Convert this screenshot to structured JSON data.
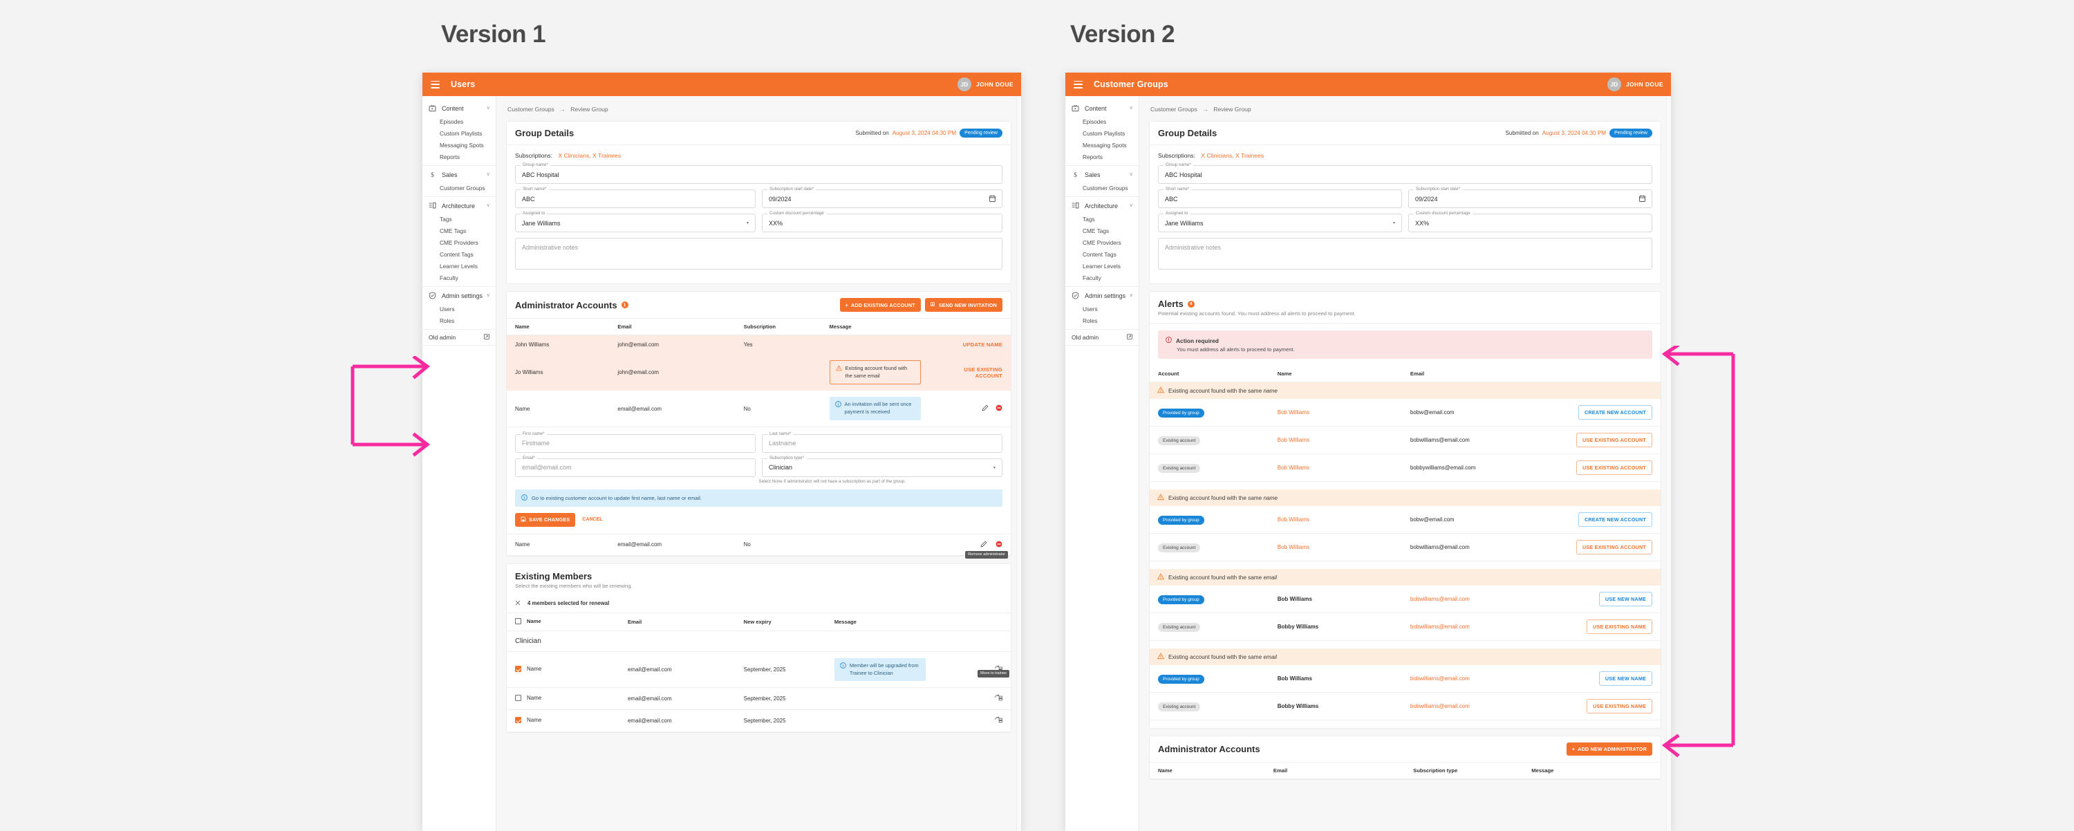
{
  "page": {
    "background": "#f4f3f3",
    "accent_orange": "#f4712b",
    "accent_blue": "#1a86d8",
    "annotation_pink": "#f72ba0"
  },
  "v1_title": "Version 1",
  "v2_title": "Version 2",
  "topbar": {
    "v1_title": "Users",
    "v2_title": "Customer Groups",
    "avatar_initials": "JD",
    "username": "JOHN DOUE",
    "menu_icon": "hamburger-icon"
  },
  "sidebar": {
    "groups": [
      {
        "label": "Content",
        "icon": "tv-icon",
        "chevron": "v",
        "items": [
          "Episodes",
          "Custom Playlists",
          "Messaging Spots",
          "Reports"
        ]
      },
      {
        "label": "Sales",
        "icon": "dollar-icon",
        "chevron": "v",
        "items": [
          "Customer Groups"
        ]
      },
      {
        "label": "Architecture",
        "icon": "layout-icon",
        "chevron": "v",
        "items": [
          "Tags",
          "CME Tags",
          "CME Providers",
          "Content Tags",
          "Learner Levels",
          "Faculty"
        ]
      },
      {
        "label": "Admin settings",
        "icon": "shield-icon",
        "chevron": "v",
        "items": [
          "Users",
          "Roles"
        ]
      }
    ],
    "footer": {
      "label": "Old admin",
      "icon": "external-link-icon"
    }
  },
  "breadcrumb": {
    "root": "Customer Groups",
    "arrow": "→",
    "current": "Review Group"
  },
  "group_details": {
    "title": "Group Details",
    "submitted_label": "Submitted on",
    "submitted_date": "August 3, 2024 04:30 PM",
    "status_chip": "Pending review",
    "subscriptions_label": "Subscriptions:",
    "subscriptions_value": "X Clinicians, X Trainees",
    "fields": {
      "group_name": {
        "legend": "Group name*",
        "value": "ABC Hospital"
      },
      "short_name": {
        "legend": "Short name*",
        "value": "ABC"
      },
      "start_date": {
        "legend": "Subscription start date*",
        "value": "09/2024",
        "icon": "calendar-icon"
      },
      "assigned_to": {
        "legend": "Assigned to",
        "value": "Jane Williams",
        "icon": "chevron-down-icon"
      },
      "discount": {
        "legend": "Custom discount percentage",
        "value": "XX%"
      },
      "notes": {
        "legend": "",
        "placeholder": "Administrative notes"
      }
    }
  },
  "v1_admin": {
    "title": "Administrator Accounts",
    "badge": "1",
    "btn_add_existing": "ADD EXISTING ACCOUNT",
    "btn_send_invitation": "SEND NEW INVITATION",
    "columns": [
      "Name",
      "Email",
      "Subscription",
      "Message"
    ],
    "rows": [
      {
        "name": "John Williams",
        "email": "john@email.com",
        "subscription": "Yes",
        "message": "",
        "action": "UPDATE NAME",
        "highlight": true
      },
      {
        "name": "Jo Williams",
        "email": "john@email.com",
        "subscription": "",
        "message": "Existing account found with the same email",
        "message_type": "warn",
        "action": "USE EXISTING ACCOUNT",
        "highlight": true
      },
      {
        "name": "Name",
        "email": "email@email.com",
        "subscription": "No",
        "message": "An invitation will be sent once payment is received",
        "message_type": "info",
        "action": "",
        "highlight": false
      }
    ],
    "edit_form": {
      "first_name": {
        "legend": "First name*",
        "placeholder": "Firstname"
      },
      "last_name": {
        "legend": "Last name*",
        "placeholder": "Lastname"
      },
      "email": {
        "legend": "Email*",
        "placeholder": "email@email.com"
      },
      "subscription_type": {
        "legend": "Subscription type*",
        "value": "Clinician"
      },
      "helper": "Select None if administrator will not have a subscription as part of the group.",
      "info": "Go to existing customer account to update first name, last name or email.",
      "save": "SAVE CHANGES",
      "cancel": "CANCEL"
    },
    "last_row": {
      "name": "Name",
      "email": "email@email.com",
      "subscription": "No"
    },
    "tooltip_remove": "Remove administrator"
  },
  "v1_members": {
    "title": "Existing Members",
    "subtitle": "Select the existing members who will be renewing.",
    "selection_text": "4 members selected for renewal",
    "clear_icon": "close-icon",
    "columns": [
      "Name",
      "Email",
      "New expiry",
      "Message"
    ],
    "group_label": "Clinician",
    "rows": [
      {
        "checked": true,
        "name": "Name",
        "email": "email@email.com",
        "expiry": "September, 2025",
        "message": "Member will be upgraded from Trainee to Clinician",
        "tooltip": "Move to trainee"
      },
      {
        "checked": false,
        "name": "Name",
        "email": "email@email.com",
        "expiry": "September, 2025",
        "message": "",
        "tooltip": ""
      },
      {
        "checked": true,
        "name": "Name",
        "email": "email@email.com",
        "expiry": "September, 2025",
        "message": "",
        "tooltip": ""
      }
    ]
  },
  "v2_alerts": {
    "title": "Alerts",
    "badge": "4",
    "subtitle": "Potential existing accounts found. You must address all alerts to proceed to payment.",
    "action_required_title": "Action required",
    "action_required_text": "You must address all alerts to proceed to payment.",
    "columns": [
      "Account",
      "Name",
      "Email"
    ],
    "groups": [
      {
        "banner_prefix": "Existing account found with the same ",
        "banner_em": "name",
        "rows": [
          {
            "tag": "Provided by group",
            "tag_style": "blue",
            "name": "Bob Williams",
            "name_style": "orange",
            "email": "bobw@email.com",
            "email_style": "dark",
            "action": "CREATE NEW ACCOUNT",
            "action_style": "blue"
          },
          {
            "tag": "Existing account",
            "tag_style": "gray",
            "name": "Bob Williams",
            "name_style": "orange",
            "email": "bobwilliams@email.com",
            "email_style": "dark",
            "action": "USE EXISTING ACCOUNT",
            "action_style": "orange"
          },
          {
            "tag": "Existing account",
            "tag_style": "gray",
            "name": "Bob Williams",
            "name_style": "orange",
            "email": "bobbywilliams@email.com",
            "email_style": "dark",
            "action": "USE EXISTING ACCOUNT",
            "action_style": "orange"
          }
        ]
      },
      {
        "banner_prefix": "Existing account found with the same ",
        "banner_em": "name",
        "rows": [
          {
            "tag": "Provided by group",
            "tag_style": "blue",
            "name": "Bob Williams",
            "name_style": "orange",
            "email": "bobw@email.com",
            "email_style": "dark",
            "action": "CREATE NEW ACCOUNT",
            "action_style": "blue"
          },
          {
            "tag": "Existing account",
            "tag_style": "gray",
            "name": "Bob Williams",
            "name_style": "orange",
            "email": "bobwilliams@email.com",
            "email_style": "dark",
            "action": "USE EXISTING ACCOUNT",
            "action_style": "orange"
          }
        ]
      },
      {
        "banner_prefix": "Existing account found with the same ",
        "banner_em": "email",
        "rows": [
          {
            "tag": "Provided by group",
            "tag_style": "blue",
            "name": "Bob Williams",
            "name_style": "dark",
            "email": "bobwilliams@email.com",
            "email_style": "orange",
            "action": "USE NEW NAME",
            "action_style": "blue"
          },
          {
            "tag": "Existing account",
            "tag_style": "gray",
            "name": "Bobby Williams",
            "name_style": "dark",
            "email": "bobwilliams@email.com",
            "email_style": "orange",
            "action": "USE EXISTING NAME",
            "action_style": "orange"
          }
        ]
      },
      {
        "banner_prefix": "Existing account found with the same ",
        "banner_em": "email",
        "rows": [
          {
            "tag": "Provided by group",
            "tag_style": "blue",
            "name": "Bob Williams",
            "name_style": "dark",
            "email": "bobwilliams@email.com",
            "email_style": "orange",
            "action": "USE NEW NAME",
            "action_style": "blue"
          },
          {
            "tag": "Existing account",
            "tag_style": "gray",
            "name": "Bobby Williams",
            "name_style": "dark",
            "email": "bobwilliams@email.com",
            "email_style": "orange",
            "action": "USE EXISTING NAME",
            "action_style": "orange"
          }
        ]
      }
    ]
  },
  "v2_admin": {
    "title": "Administrator Accounts",
    "btn_add": "ADD NEW ADMINISTRATOR",
    "columns": [
      "Name",
      "Email",
      "Subscription type",
      "Message"
    ]
  }
}
